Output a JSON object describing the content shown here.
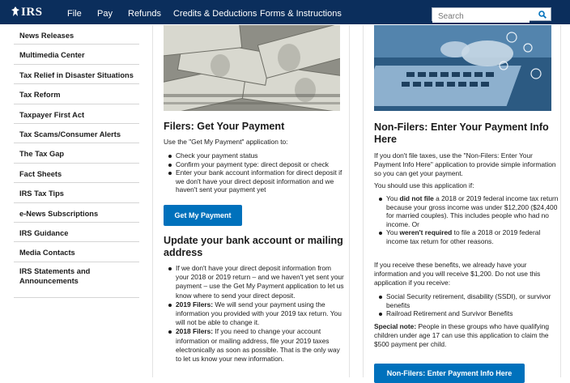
{
  "header": {
    "logo": "IRS",
    "nav": [
      "File",
      "Pay",
      "Refunds",
      "Credits & Deductions",
      "Forms & Instructions"
    ],
    "search_placeholder": "Search"
  },
  "sidebar": {
    "items": [
      "News Releases",
      "Multimedia Center",
      "Tax Relief in Disaster Situations",
      "Tax Reform",
      "Taxpayer First Act",
      "Tax Scams/Consumer Alerts",
      "The Tax Gap",
      "Fact Sheets",
      "IRS Tax Tips",
      "e-News Subscriptions",
      "IRS Guidance",
      "Media Contacts",
      "IRS Statements and Announcements"
    ]
  },
  "filers": {
    "title": "Filers: Get Your Payment",
    "intro": "Use the \"Get My Payment\" application to:",
    "bullets": [
      "Check your payment status",
      "Confirm your payment type: direct deposit or check",
      "Enter your bank account information for direct deposit if we don't have your direct deposit information and we haven't sent your payment yet"
    ],
    "button": "Get My Payment"
  },
  "update": {
    "title": "Update your bank account or mailing address",
    "b1": "If we don't have your direct deposit information from your 2018 or 2019 return – and we haven't yet sent your payment – use the Get My Payment application to let us know where to send your direct deposit.",
    "b2_bold": "2019 Filers:",
    "b2": " We will send your payment using the information you provided with your 2019 tax return. You will not be able to change it.",
    "b3_bold": "2018 Filers:",
    "b3": " If you need to change your account information or mailing address, file your 2019 taxes electronically as soon as possible. That is the only way to let us know your new information."
  },
  "nonfilers": {
    "title": "Non-Filers: Enter Your Payment Info Here",
    "intro": "If you don't file taxes, use the \"Non-Filers: Enter Your Payment Info Here\" application to provide simple information so you can get your payment.",
    "should_use": "You should use this application if:",
    "b1_pre": "You ",
    "b1_bold": "did not file",
    "b1_post": " a 2018 or 2019 federal income tax return because your gross income was under $12,200 ($24,400 for married couples). This includes people who had no income. Or",
    "b2_pre": "You ",
    "b2_bold": "weren't required",
    "b2_post": " to file a 2018 or 2019 federal income tax return for other reasons.",
    "benefits": "If you receive these benefits, we already have your information and you will receive $1,200. Do not use this application if you receive:",
    "benefit_items": [
      "Social Security retirement, disability (SSDI), or survivor benefits",
      "Railroad Retirement and Survivor Benefits"
    ],
    "special_bold": "Special note:",
    "special": " People in these groups who have qualifying children under age 17 can use this application to claim the $500 payment per child.",
    "button": "Non-Filers: Enter Payment Info Here"
  }
}
